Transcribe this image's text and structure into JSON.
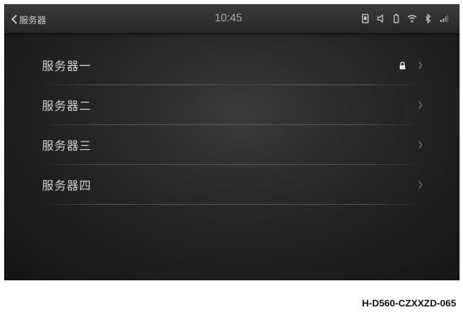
{
  "header": {
    "back_title": "服务器",
    "clock": "10:45"
  },
  "status_icons": [
    "phone-icon",
    "volume-icon",
    "battery-icon",
    "wifi-icon",
    "bluetooth-icon",
    "signal-icon"
  ],
  "servers": [
    {
      "label": "服务器一",
      "locked": true
    },
    {
      "label": "服务器二",
      "locked": false
    },
    {
      "label": "服务器三",
      "locked": false
    },
    {
      "label": "服务器四",
      "locked": false
    }
  ],
  "caption": "H-D560-CZXXZD-065",
  "colors": {
    "text": "#d2d2d2",
    "icon": "#bdbdbd",
    "chevron": "#6e6e6e",
    "background": "#262626"
  }
}
